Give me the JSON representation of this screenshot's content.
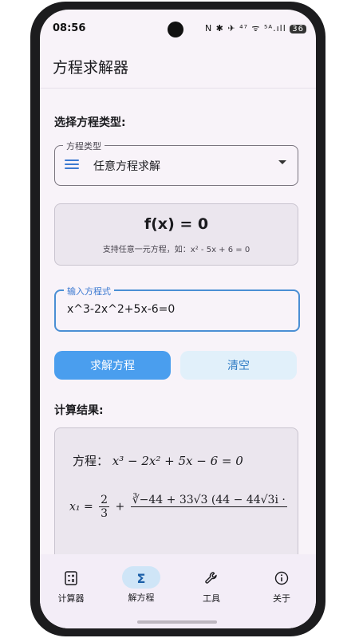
{
  "status": {
    "time": "08:56",
    "icons": "N ✱ ✈ ⁴⁷ ᯤ ⁵ᴬ.ıll",
    "battery": "36"
  },
  "app": {
    "title": "方程求解器"
  },
  "type_section": {
    "label": "选择方程类型:",
    "dropdown_legend": "方程类型",
    "dropdown_value": "任意方程求解"
  },
  "formula_card": {
    "title": "f(x) = 0",
    "subtitle": "支持任意一元方程，如：x² - 5x + 6 = 0"
  },
  "equation_input": {
    "legend": "输入方程式",
    "value": "x^3-2x^2+5x-6=0"
  },
  "buttons": {
    "solve": "求解方程",
    "clear": "清空"
  },
  "result_section": {
    "label": "计算结果:",
    "equation_prefix": "方程：",
    "equation": "x³ − 2x² + 5x − 6 = 0",
    "x1_lhs": "x₁ =",
    "x1_frac_num": "2",
    "x1_frac_den": "3",
    "x1_plus": "+",
    "x1_radical_num": "∛−44 + 33√3 (44 − 44√3i ·"
  },
  "nav": {
    "items": [
      {
        "label": "计算器",
        "icon": "calculator-icon"
      },
      {
        "label": "解方程",
        "icon": "sigma-icon",
        "active": true
      },
      {
        "label": "工具",
        "icon": "wrench-icon"
      },
      {
        "label": "关于",
        "icon": "info-icon"
      }
    ]
  },
  "colors": {
    "accent": "#4a9eee",
    "accent_light": "#e1f0fa",
    "background": "#f8f3f9"
  }
}
